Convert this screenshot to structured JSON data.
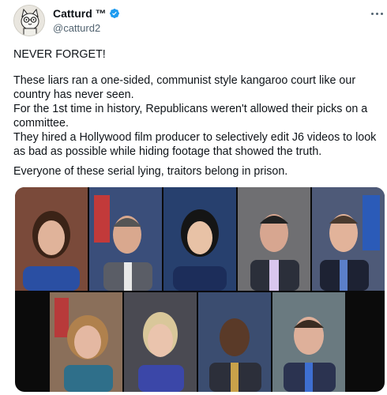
{
  "author": {
    "display_name": "Catturd ™",
    "handle": "@catturd2",
    "avatar_icon": "cartoon-cat-avatar-icon",
    "verified_icon": "verified-badge-icon",
    "verified_color": "#1d9bf0"
  },
  "menu": {
    "icon": "more-options-icon"
  },
  "tweet": {
    "line1": "NEVER FORGET!",
    "body": "These liars ran a one-sided, communist style kangaroo court like our\ncountry has never seen.\nFor the 1st time in history, Republicans weren't allowed their picks on a\ncommittee.\nThey hired a Hollywood film producer to selectively edit J6 videos to look\nas bad as possible while hiding footage that showed the truth.",
    "closing": "Everyone of these serial lying, traitors belong in prison."
  },
  "media": {
    "kind": "photo-collage",
    "photo_count": 9
  }
}
